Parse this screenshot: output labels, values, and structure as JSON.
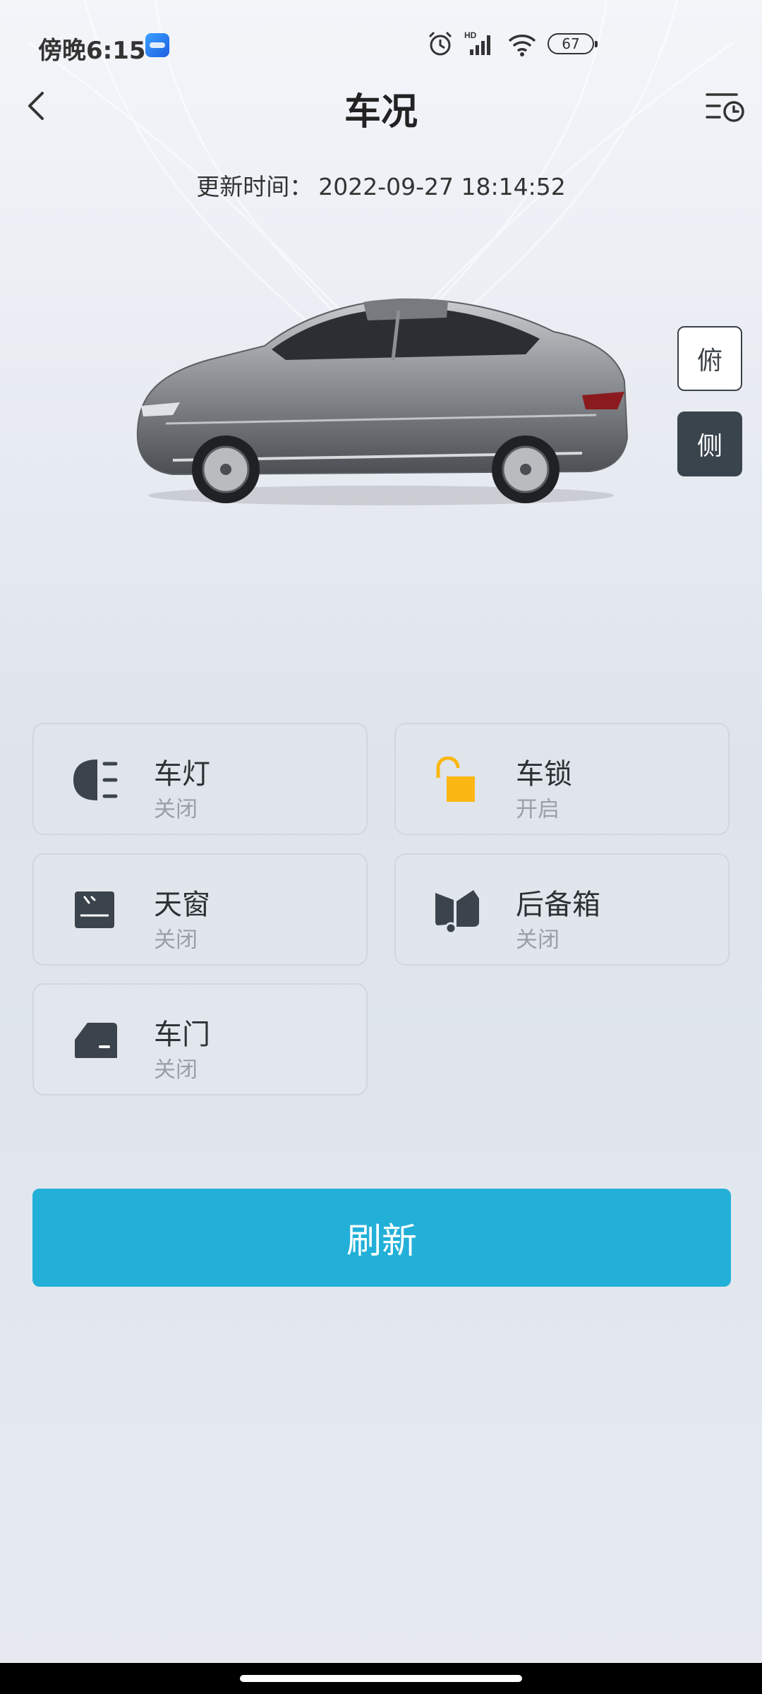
{
  "status_bar": {
    "time": "傍晚6:15",
    "network_badge": "HD",
    "battery": "67"
  },
  "header": {
    "title": "车况"
  },
  "update": {
    "label": "更新时间：",
    "time": "2022-09-27 18:14:52"
  },
  "view_toggle": {
    "top_label": "俯",
    "side_label": "侧",
    "selected": "侧"
  },
  "cards": [
    {
      "name": "车灯",
      "state": "关闭",
      "icon": "headlight-icon"
    },
    {
      "name": "车锁",
      "state": "开启",
      "icon": "unlocked-padlock-icon",
      "color": "#fbb714"
    },
    {
      "name": "天窗",
      "state": "关闭",
      "icon": "sunroof-icon"
    },
    {
      "name": "后备箱",
      "state": "关闭",
      "icon": "trunk-icon"
    },
    {
      "name": "车门",
      "state": "关闭",
      "icon": "car-door-icon"
    }
  ],
  "refresh": {
    "label": "刷新"
  },
  "colors": {
    "accent": "#22b0d8",
    "dark": "#3a444d",
    "lock_open": "#fbb714"
  }
}
